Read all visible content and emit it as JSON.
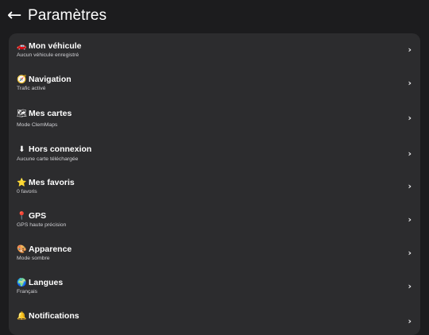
{
  "header": {
    "title": "Paramètres"
  },
  "settings": [
    {
      "emoji": "🚗",
      "label": "Mon véhicule",
      "sub": "Aucun véhicule enregistré"
    },
    {
      "emoji": "🧭",
      "label": "Navigation",
      "sub": "Trafic activé"
    },
    {
      "emoji": "🗺",
      "label": "Mes cartes",
      "sub": "Mode ClemMaps"
    },
    {
      "emoji": "⬇",
      "label": "Hors connexion",
      "sub": "Aucune carte téléchargée"
    },
    {
      "emoji": "⭐",
      "label": "Mes favoris",
      "sub": "0 favoris"
    },
    {
      "emoji": "📍",
      "label": "GPS",
      "sub": "GPS haute précision"
    },
    {
      "emoji": "🎨",
      "label": "Apparence",
      "sub": "Mode sombre"
    },
    {
      "emoji": "🌍",
      "label": "Langues",
      "sub": "Français"
    },
    {
      "emoji": "🔔",
      "label": "Notifications",
      "sub": ""
    }
  ]
}
